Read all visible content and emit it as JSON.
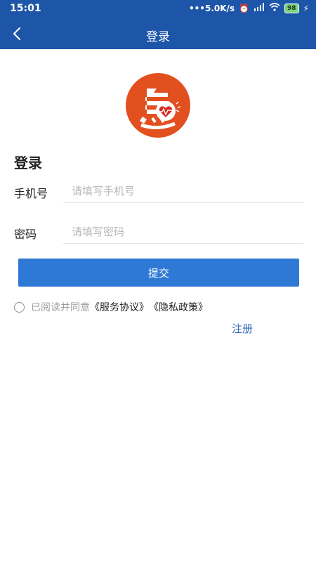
{
  "status_bar": {
    "time": "15:01",
    "network_speed": "5.0K/s",
    "battery": "98"
  },
  "nav": {
    "title": "登录"
  },
  "form": {
    "heading": "登录",
    "phone_label": "手机号",
    "phone_placeholder": "请填写手机号",
    "password_label": "密码",
    "password_placeholder": "请填写密码",
    "submit_label": "提交"
  },
  "agreement": {
    "prefix": "已阅读并同意",
    "service_link": "《服务协议》",
    "privacy_link": "《隐私政策》"
  },
  "register_label": "注册",
  "colors": {
    "primary": "#1d56a8",
    "button": "#2f79d6",
    "logo_bg": "#e2501f"
  }
}
